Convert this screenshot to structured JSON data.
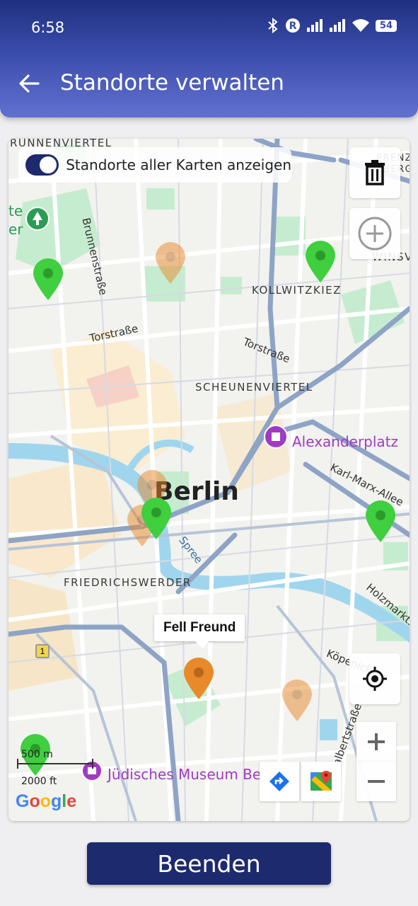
{
  "status_bar": {
    "time": "6:58",
    "battery": "54"
  },
  "app_bar": {
    "title": "Standorte verwalten"
  },
  "map": {
    "toggle_label": "Standorte aller Karten anzeigen",
    "toggle_on": true,
    "labels": {
      "brunnenviertel": "RUNNENVIERTEL",
      "prenzlauer": "PRENZLAU",
      "prenzlauer2": "BERG",
      "winsv": "WINSV",
      "kollwitzkiez": "KOLLWITZKIEZ",
      "scheunenviertel": "SCHEUNENVIERTEL",
      "friedrichswerder": "FRIEDRICHSWERDER",
      "city": "Berlin",
      "alexanderplatz": "Alexanderplatz",
      "juedisches_museum": "Jüdisches Museum Berlin",
      "brunnenstrasse": "Brunnenstraße",
      "torstrasse1": "Torstraße",
      "torstrasse2": "Torstraße",
      "karl_marx_allee": "Karl-Marx-Allee",
      "spree": "Spree",
      "holzmarkt": "Holzmarkts",
      "koepenicker": "Köpenick",
      "adalbert": "Adalbertstraße",
      "park_text_1": "te",
      "park_text_2": "er"
    },
    "selected_marker_label": "Fell Freund",
    "scale": {
      "metric": "500 m",
      "imperial": "2000 ft"
    },
    "attribution": "Google",
    "road_shield": "1"
  },
  "colors": {
    "primary": "#1d2a6e",
    "marker_green": "#3fcf3f",
    "marker_orange": "#e8892a",
    "poi_purple": "#a03bc1"
  },
  "icons": {
    "back": "arrow-left-icon",
    "delete": "trash-icon",
    "add": "plus-circle-icon",
    "locate": "my-location-icon",
    "directions": "directions-icon",
    "open_maps": "google-maps-icon"
  },
  "footer": {
    "finish_label": "Beenden"
  }
}
